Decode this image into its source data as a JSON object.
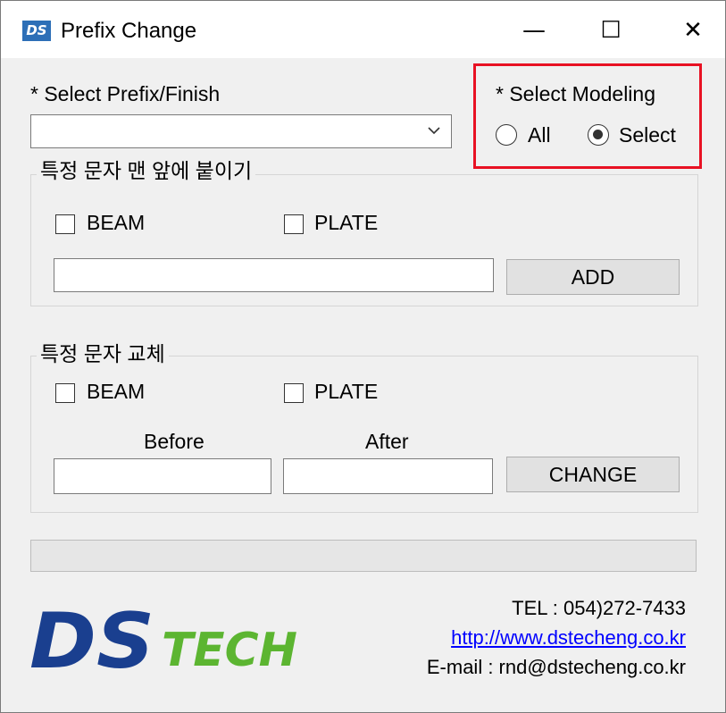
{
  "window": {
    "title": "Prefix Change",
    "icon_text": "DS",
    "controls": {
      "minimize": "—",
      "maximize": "☐",
      "close": "✕"
    }
  },
  "prefix": {
    "label": "* Select Prefix/Finish",
    "selected": ""
  },
  "modeling": {
    "label": "* Select Modeling",
    "options": [
      {
        "label": "All",
        "checked": false
      },
      {
        "label": "Select",
        "checked": true
      }
    ],
    "highlight_color": "#e81123"
  },
  "add_group": {
    "legend": "특정 문자 맨 앞에 붙이기",
    "beam_label": "BEAM",
    "beam_checked": false,
    "plate_label": "PLATE",
    "plate_checked": false,
    "text_value": "",
    "button_label": "ADD"
  },
  "change_group": {
    "legend": "특정 문자 교체",
    "beam_label": "BEAM",
    "beam_checked": false,
    "plate_label": "PLATE",
    "plate_checked": false,
    "before_label": "Before",
    "after_label": "After",
    "before_value": "",
    "after_value": "",
    "button_label": "CHANGE"
  },
  "progress": {
    "value": 0
  },
  "logo": {
    "text_ds": "DS",
    "text_tech": "TECH",
    "ds_color": "#1a3f8f",
    "tech_color": "#5cb531"
  },
  "contact": {
    "tel": "TEL : 054)272-7433",
    "url": "http://www.dstecheng.co.kr",
    "email": "E-mail : rnd@dstecheng.co.kr"
  }
}
